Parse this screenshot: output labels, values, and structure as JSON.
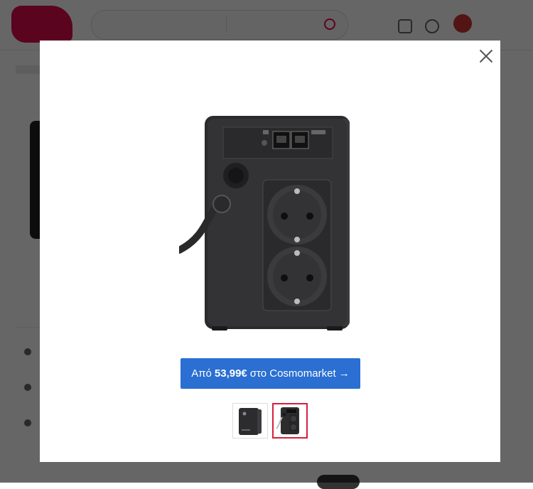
{
  "modal": {
    "cta": {
      "prefix": "Από",
      "price": "53,99€",
      "suffix": "στο Cosmomarket →"
    },
    "thumbnails": [
      {
        "label": "front",
        "selected": false
      },
      {
        "label": "back",
        "selected": true
      }
    ]
  },
  "colors": {
    "overlay": "rgba(0,0,0,0.6)",
    "cta_background": "#2a6fd1",
    "thumbnail_selected_border": "#d61f3d",
    "brand": "#e30a4e"
  },
  "icons": {
    "close": "close-icon",
    "search": "search-icon"
  }
}
